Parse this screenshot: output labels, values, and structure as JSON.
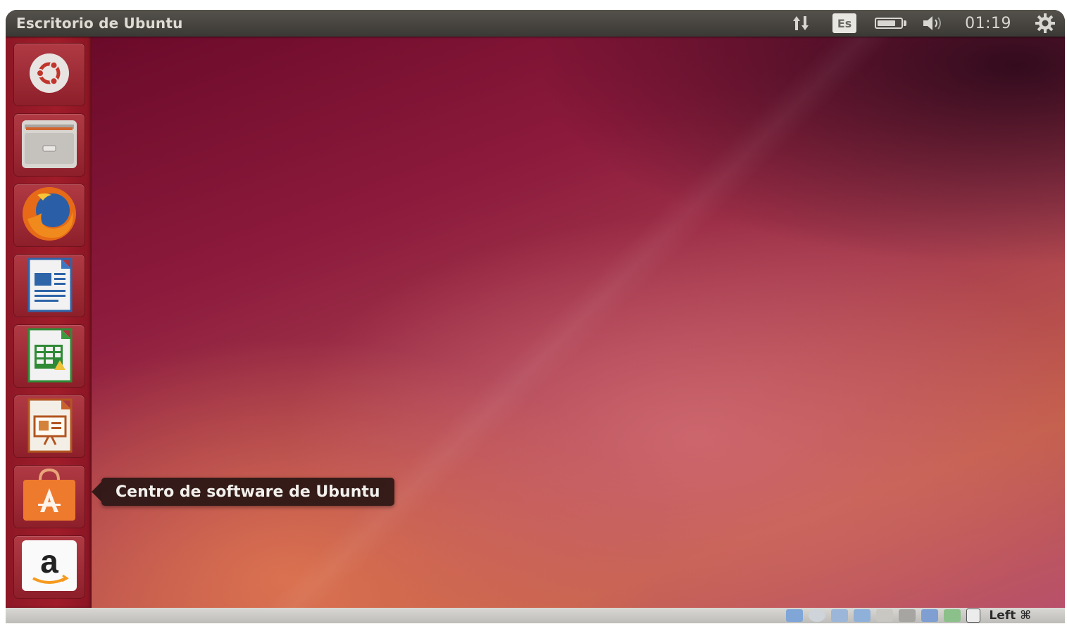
{
  "top_panel": {
    "title": "Escritorio de Ubuntu",
    "keyboard_layout": "Es",
    "clock": "01:19",
    "icons": [
      "network-updown-icon",
      "keyboard-layout-icon",
      "battery-icon",
      "volume-icon",
      "gear-icon"
    ]
  },
  "launcher": {
    "items": [
      {
        "name": "dash-home",
        "icon": "ubuntu-logo-icon"
      },
      {
        "name": "files",
        "icon": "file-cabinet-icon"
      },
      {
        "name": "firefox",
        "icon": "firefox-icon"
      },
      {
        "name": "libreoffice-writer",
        "icon": "writer-document-icon"
      },
      {
        "name": "libreoffice-calc",
        "icon": "calc-spreadsheet-icon"
      },
      {
        "name": "libreoffice-impress",
        "icon": "impress-presentation-icon"
      },
      {
        "name": "ubuntu-software-center",
        "icon": "shopping-bag-icon"
      },
      {
        "name": "amazon",
        "icon": "amazon-icon"
      }
    ]
  },
  "tooltip": {
    "text": "Centro de software de Ubuntu"
  },
  "statusbar": {
    "host_key": "Left ⌘",
    "tray_icons": [
      "hdd-icon",
      "cd-icon",
      "usb-icon",
      "network-icon",
      "shared-folder-icon",
      "display-icon",
      "video-capture-icon",
      "mouse-integration-icon",
      "arrow-icon"
    ]
  },
  "colors": {
    "panel": "#3b3935",
    "launcher": "#a01c2a",
    "desktop_dark": "#6b0a2a",
    "desktop_warm": "#c4604b"
  }
}
